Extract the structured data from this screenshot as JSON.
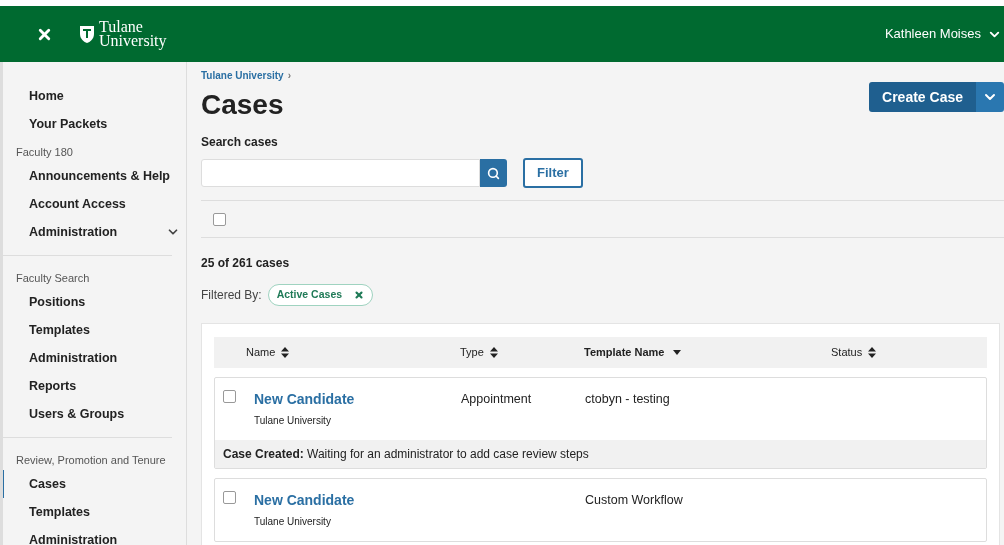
{
  "header": {
    "brand_line1": "Tulane",
    "brand_line2": "University",
    "user": "Kathleen Moises"
  },
  "sidebar": {
    "sections": [
      {
        "items": [
          {
            "label": "Home",
            "selected": false,
            "has_submenu": false
          },
          {
            "label": "Your Packets",
            "selected": false,
            "has_submenu": false
          }
        ]
      },
      {
        "label": "Faculty 180",
        "items": [
          {
            "label": "Announcements & Help",
            "selected": false,
            "has_submenu": false
          },
          {
            "label": "Account Access",
            "selected": false,
            "has_submenu": false
          },
          {
            "label": "Administration",
            "selected": false,
            "has_submenu": true
          }
        ]
      },
      {
        "label": "Faculty Search",
        "items": [
          {
            "label": "Positions",
            "selected": false,
            "has_submenu": false
          },
          {
            "label": "Templates",
            "selected": false,
            "has_submenu": false
          },
          {
            "label": "Administration",
            "selected": false,
            "has_submenu": false
          },
          {
            "label": "Reports",
            "selected": false,
            "has_submenu": false
          },
          {
            "label": "Users & Groups",
            "selected": false,
            "has_submenu": false
          }
        ]
      },
      {
        "label": "Review, Promotion and Tenure",
        "items": [
          {
            "label": "Cases",
            "selected": true,
            "has_submenu": false
          },
          {
            "label": "Templates",
            "selected": false,
            "has_submenu": false
          },
          {
            "label": "Administration",
            "selected": false,
            "has_submenu": false
          }
        ]
      }
    ]
  },
  "breadcrumb": "Tulane University",
  "breadcrumb_sep": "›",
  "title": "Cases",
  "create_button": "Create Case",
  "search": {
    "label": "Search cases"
  },
  "filter_button": "Filter",
  "select_all": {
    "checked": false
  },
  "count": "25 of 261 cases",
  "filtered_by": {
    "label": "Filtered By:",
    "chips": [
      "Active Cases"
    ]
  },
  "table": {
    "columns": [
      {
        "label": "Name",
        "sorted": false
      },
      {
        "label": "Type",
        "sorted": false
      },
      {
        "label": "Template Name",
        "sorted": true
      },
      {
        "label": "Status",
        "sorted": false
      }
    ],
    "rows": [
      {
        "name": "New Candidate",
        "org": "Tulane University",
        "type": "Appointment",
        "template": "ctobyn - testing",
        "checked": false,
        "note_label": "Case Created:",
        "note": "Waiting for an administrator to add case review steps"
      },
      {
        "name": "New Candidate",
        "org": "Tulane University",
        "template": "Custom Workflow",
        "checked": false
      }
    ]
  }
}
